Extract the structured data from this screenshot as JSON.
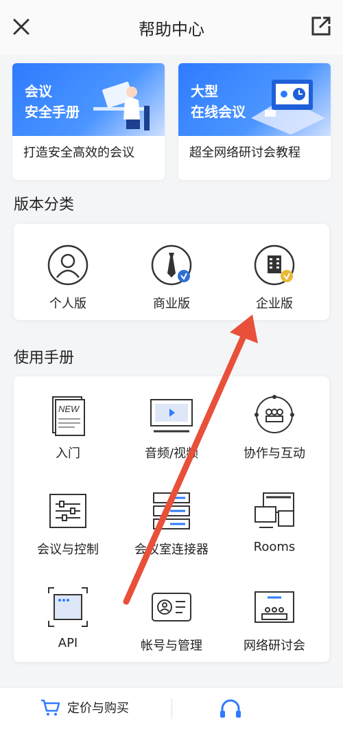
{
  "header": {
    "title": "帮助中心"
  },
  "banners": [
    {
      "art_title": "会议\n安全手册",
      "caption": "打造安全高效的会议"
    },
    {
      "art_title": "大型\n在线会议",
      "caption": "超全网络研讨会教程"
    }
  ],
  "editions": {
    "title": "版本分类",
    "items": [
      {
        "label": "个人版",
        "icon": "person-icon"
      },
      {
        "label": "商业版",
        "icon": "tie-icon"
      },
      {
        "label": "企业版",
        "icon": "building-icon"
      }
    ]
  },
  "manual": {
    "title": "使用手册",
    "items": [
      {
        "label": "入门",
        "icon": "new-doc-icon"
      },
      {
        "label": "音频/视频",
        "icon": "monitor-icon"
      },
      {
        "label": "协作与互动",
        "icon": "group-icon"
      },
      {
        "label": "会议与控制",
        "icon": "sliders-icon"
      },
      {
        "label": "会议室连接器",
        "icon": "server-icon"
      },
      {
        "label": "Rooms",
        "icon": "rooms-icon"
      },
      {
        "label": "API",
        "icon": "api-icon"
      },
      {
        "label": "帐号与管理",
        "icon": "id-card-icon"
      },
      {
        "label": "网络研讨会",
        "icon": "webinar-icon"
      }
    ]
  },
  "bottom": {
    "buy_label": "定价与购买"
  },
  "colors": {
    "accent": "#2e7bff",
    "arrow": "#e8503a",
    "badge_blue": "#2d6fd6",
    "badge_gold": "#e8b936"
  }
}
